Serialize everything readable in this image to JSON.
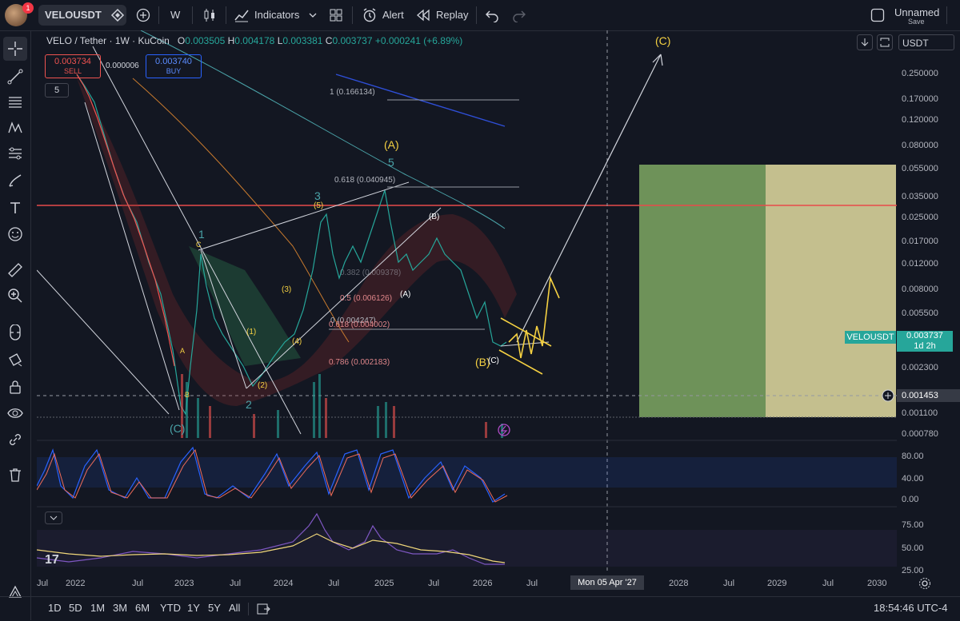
{
  "header": {
    "notification_count": "1",
    "symbol": "VELOUSDT",
    "interval": "W",
    "indicators_label": "Indicators",
    "alert_label": "Alert",
    "replay_label": "Replay",
    "layout_name": "Unnamed",
    "save_label": "Save"
  },
  "legend": {
    "title": "VELO / Tether · 1W · KuCoin",
    "o_label": "O",
    "o": "0.003505",
    "h_label": "H",
    "h": "0.004178",
    "l_label": "L",
    "l": "0.003381",
    "c_label": "C",
    "c": "0.003737",
    "change": "+0.000241 (+6.89%)",
    "sell_price": "0.003734",
    "sell_label": "SELL",
    "spread": "0.000006",
    "buy_price": "0.003740",
    "buy_label": "BUY",
    "indicator_count": "5"
  },
  "price_scale": {
    "currency": "USDT",
    "ticks": [
      "0.250000",
      "0.170000",
      "0.120000",
      "0.080000",
      "0.055000",
      "0.035000",
      "0.025000",
      "0.017000",
      "0.012000",
      "0.008000",
      "0.005500",
      "0.003737",
      "0.002300",
      "0.001453",
      "0.001100",
      "0.000780"
    ],
    "current_symbol": "VELOUSDT",
    "current_price": "0.003737",
    "countdown": "1d 2h",
    "crosshair_price": "0.001453"
  },
  "osc1_scale": [
    "80.00",
    "40.00",
    "0.00"
  ],
  "osc2_scale": [
    "75.00",
    "50.00",
    "25.00"
  ],
  "time_scale": {
    "labels": [
      "Jul",
      "2022",
      "Jul",
      "2023",
      "Jul",
      "2024",
      "Jul",
      "2025",
      "Jul",
      "2026",
      "Jul",
      "2028",
      "Jul",
      "2029",
      "Jul",
      "2030"
    ],
    "crosshair_date": "Mon 05 Apr '27"
  },
  "annotations": {
    "fib_1": "1 (0.166134)",
    "fib_618": "0.618 (0.040945)",
    "fib_0": "0 (0.004247)",
    "fib_618b": "0.618 (0.004002)",
    "fib_786": "0.786 (0.002183)",
    "fib_5": "0.5 (0.006126)",
    "fib_382": "0.382 (0.009378)",
    "wave_C_big": "(C)",
    "wave_A": "(A)",
    "wave_B": "(B)",
    "wave_C_low": "(C)",
    "wave_1": "1",
    "wave_2": "2",
    "wave_3": "3",
    "wave_5": "5",
    "sub_1": "(1)",
    "sub_2": "(2)",
    "sub_3": "(3)",
    "sub_4": "(4)",
    "sub_5": "(5)",
    "sub_A": "(A)",
    "sub_B": "(B)",
    "sub_C": "(C)",
    "circ_A": "A",
    "circ_B": "B",
    "circ_C": "C"
  },
  "bottom": {
    "ranges": [
      "1D",
      "5D",
      "1M",
      "3M",
      "6M",
      "YTD",
      "1Y",
      "5Y",
      "All"
    ],
    "clock": "18:54:46 UTC-4"
  },
  "colors": {
    "background": "#131722",
    "up": "#26a69a",
    "down": "#ef5350",
    "wave": "#f5d142",
    "target_green": "#7fa863",
    "target_yellow": "#d8d19a",
    "resistance": "#e84a4a"
  }
}
